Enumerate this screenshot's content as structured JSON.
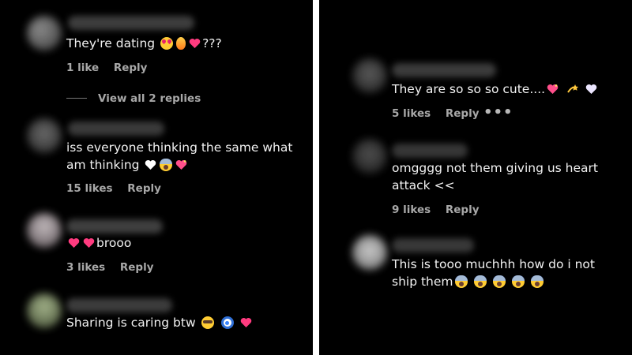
{
  "left_panel": {
    "comments": [
      {
        "text": "They're dating",
        "text_suffix": "???",
        "emojis_inline": [
          "heart-eyes-icon",
          "fire-icon",
          "pink-heart-icon"
        ],
        "likes": "1 like",
        "reply": "Reply",
        "view_replies": "View all 2 replies"
      },
      {
        "line1": "iss everyone thinking the same what",
        "line2": "am thinking",
        "emojis_inline": [
          "white-heart-icon",
          "screaming-face-icon",
          "sparkling-heart-icon"
        ],
        "likes": "15 likes",
        "reply": "Reply"
      },
      {
        "text": "brooo",
        "emojis_inline": [
          "pink-heart-icon",
          "pink-heart-icon"
        ],
        "likes": "3 likes",
        "reply": "Reply"
      },
      {
        "text": "Sharing is caring btw",
        "emojis_inline": [
          "pleading-face-icon",
          "nazar-amulet-icon",
          "pink-heart-icon"
        ]
      }
    ]
  },
  "right_panel": {
    "comments": [
      {
        "text": "They are so so so cute....",
        "emojis_inline": [
          "sparkling-heart-icon",
          "dizzy-icon",
          "white-heart-icon"
        ],
        "likes": "5 likes",
        "reply": "Reply",
        "more": "•••"
      },
      {
        "line1": "omgggg not them giving us heart",
        "line2": "attack <<",
        "likes": "9 likes",
        "reply": "Reply"
      },
      {
        "line1": "This is tooo muchhh how do i not",
        "line2": "ship them",
        "emojis_inline": [
          "screaming-face-icon",
          "screaming-face-icon",
          "screaming-face-icon",
          "screaming-face-icon",
          "screaming-face-icon"
        ]
      }
    ]
  },
  "colors": {
    "background": "#000000",
    "text": "#f2f2f2",
    "meta_text": "#a8a8a8",
    "separator": "#ffffff",
    "heart": "#ff3b7f"
  }
}
